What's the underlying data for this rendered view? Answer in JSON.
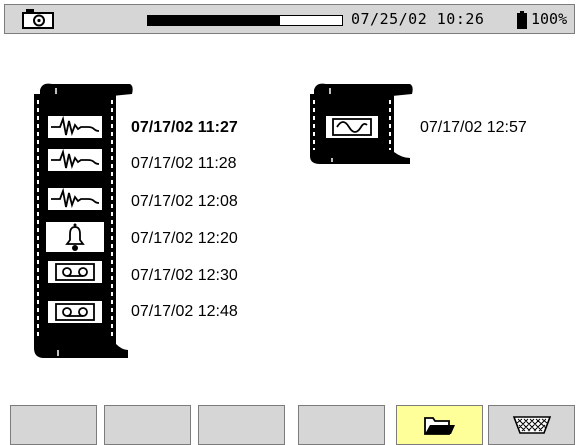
{
  "status_bar": {
    "camera_icon": "camera-icon",
    "progress_percent": 68,
    "datetime": "07/25/02 10:26",
    "battery_icon": "battery-icon",
    "battery_percent": "100%"
  },
  "recording_list": {
    "items": [
      {
        "icon": "transient-waveform-icon",
        "label": "07/17/02  11:27",
        "selected": true
      },
      {
        "icon": "transient-waveform-icon",
        "label": "07/17/02  11:28",
        "selected": false
      },
      {
        "icon": "transient-waveform-icon",
        "label": "07/17/02  12:08",
        "selected": false
      },
      {
        "icon": "alarm-bell-icon",
        "label": "07/17/02  12:20",
        "selected": false
      },
      {
        "icon": "recording-cassette-icon",
        "label": "07/17/02  12:30",
        "selected": false
      },
      {
        "icon": "recording-cassette-icon",
        "label": "07/17/02  12:48",
        "selected": false
      }
    ]
  },
  "snapshot_list": {
    "items": [
      {
        "icon": "sine-wave-icon",
        "label": "07/17/02  12:57"
      }
    ]
  },
  "function_keys": [
    {
      "icon": null,
      "active": false
    },
    {
      "icon": null,
      "active": false
    },
    {
      "icon": null,
      "active": false
    },
    {
      "icon": null,
      "active": false
    },
    {
      "icon": "open-folder-icon",
      "active": true
    },
    {
      "icon": "trash-bin-icon",
      "active": false
    }
  ],
  "colors": {
    "bar_background": "#d6d6d6",
    "active_key": "#ffff99"
  }
}
